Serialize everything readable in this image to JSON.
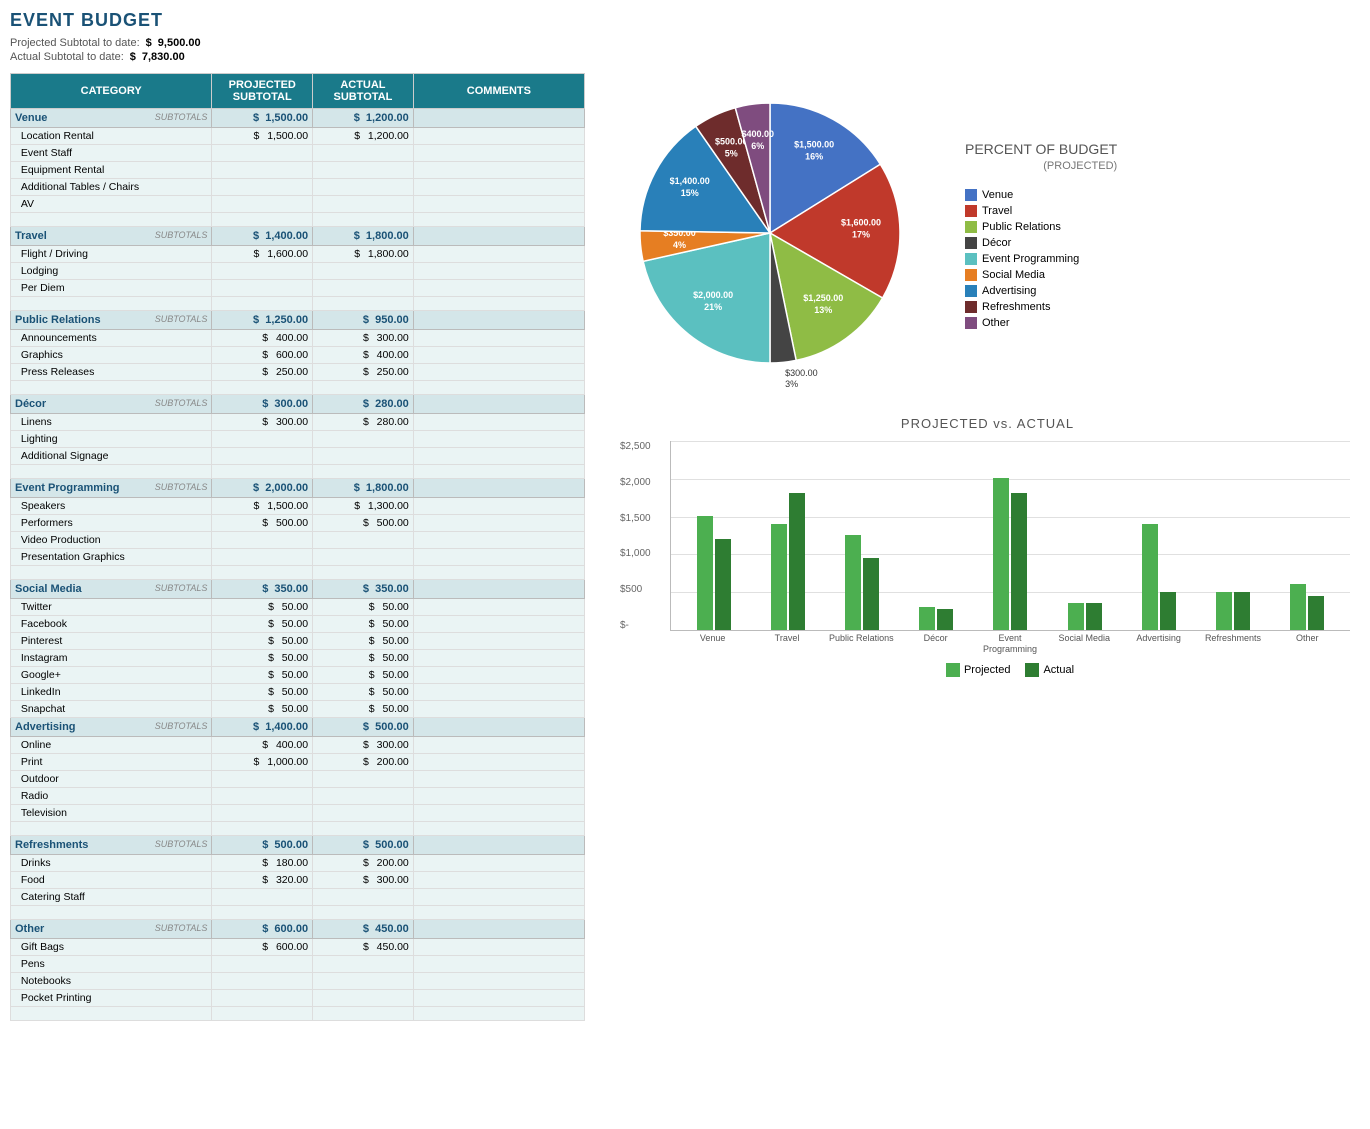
{
  "title": "EVENT BUDGET",
  "summary": {
    "projected_label": "Projected Subtotal to date:",
    "projected_dollar": "$",
    "projected_value": "9,500.00",
    "actual_label": "Actual Subtotal to date:",
    "actual_dollar": "$",
    "actual_value": "7,830.00"
  },
  "table": {
    "headers": {
      "category": "CATEGORY",
      "projected": "PROJECTED SUBTOTAL",
      "actual": "ACTUAL SUBTOTAL",
      "comments": "COMMENTS"
    },
    "categories": [
      {
        "name": "Venue",
        "projected": "1,500.00",
        "actual": "1,200.00",
        "items": [
          {
            "name": "Location Rental",
            "proj": "1,500.00",
            "act": "1,200.00"
          },
          {
            "name": "Event Staff",
            "proj": "",
            "act": ""
          },
          {
            "name": "Equipment Rental",
            "proj": "",
            "act": ""
          },
          {
            "name": "Additional Tables / Chairs",
            "proj": "",
            "act": ""
          },
          {
            "name": "AV",
            "proj": "",
            "act": ""
          }
        ],
        "empty_rows": 1
      },
      {
        "name": "Travel",
        "projected": "1,400.00",
        "actual": "1,800.00",
        "items": [
          {
            "name": "Flight / Driving",
            "proj": "1,600.00",
            "act": "1,800.00"
          },
          {
            "name": "Lodging",
            "proj": "",
            "act": ""
          },
          {
            "name": "Per Diem",
            "proj": "",
            "act": ""
          }
        ],
        "empty_rows": 1
      },
      {
        "name": "Public Relations",
        "projected": "1,250.00",
        "actual": "950.00",
        "items": [
          {
            "name": "Announcements",
            "proj": "400.00",
            "act": "300.00"
          },
          {
            "name": "Graphics",
            "proj": "600.00",
            "act": "400.00"
          },
          {
            "name": "Press Releases",
            "proj": "250.00",
            "act": "250.00"
          }
        ],
        "empty_rows": 1
      },
      {
        "name": "Décor",
        "projected": "300.00",
        "actual": "280.00",
        "items": [
          {
            "name": "Linens",
            "proj": "300.00",
            "act": "280.00"
          },
          {
            "name": "Lighting",
            "proj": "",
            "act": ""
          },
          {
            "name": "Additional Signage",
            "proj": "",
            "act": ""
          }
        ],
        "empty_rows": 1
      },
      {
        "name": "Event Programming",
        "projected": "2,000.00",
        "actual": "1,800.00",
        "items": [
          {
            "name": "Speakers",
            "proj": "1,500.00",
            "act": "1,300.00"
          },
          {
            "name": "Performers",
            "proj": "500.00",
            "act": "500.00"
          },
          {
            "name": "Video Production",
            "proj": "",
            "act": ""
          },
          {
            "name": "Presentation Graphics",
            "proj": "",
            "act": ""
          }
        ],
        "empty_rows": 1
      },
      {
        "name": "Social Media",
        "projected": "350.00",
        "actual": "350.00",
        "items": [
          {
            "name": "Twitter",
            "proj": "50.00",
            "act": "50.00"
          },
          {
            "name": "Facebook",
            "proj": "50.00",
            "act": "50.00"
          },
          {
            "name": "Pinterest",
            "proj": "50.00",
            "act": "50.00"
          },
          {
            "name": "Instagram",
            "proj": "50.00",
            "act": "50.00"
          },
          {
            "name": "Google+",
            "proj": "50.00",
            "act": "50.00"
          },
          {
            "name": "LinkedIn",
            "proj": "50.00",
            "act": "50.00"
          },
          {
            "name": "Snapchat",
            "proj": "50.00",
            "act": "50.00"
          }
        ],
        "empty_rows": 0
      },
      {
        "name": "Advertising",
        "projected": "1,400.00",
        "actual": "500.00",
        "items": [
          {
            "name": "Online",
            "proj": "400.00",
            "act": "300.00"
          },
          {
            "name": "Print",
            "proj": "1,000.00",
            "act": "200.00"
          },
          {
            "name": "Outdoor",
            "proj": "",
            "act": ""
          },
          {
            "name": "Radio",
            "proj": "",
            "act": ""
          },
          {
            "name": "Television",
            "proj": "",
            "act": ""
          }
        ],
        "empty_rows": 1
      },
      {
        "name": "Refreshments",
        "projected": "500.00",
        "actual": "500.00",
        "items": [
          {
            "name": "Drinks",
            "proj": "180.00",
            "act": "200.00"
          },
          {
            "name": "Food",
            "proj": "320.00",
            "act": "300.00"
          },
          {
            "name": "Catering Staff",
            "proj": "",
            "act": ""
          }
        ],
        "empty_rows": 1
      },
      {
        "name": "Other",
        "projected": "600.00",
        "actual": "450.00",
        "items": [
          {
            "name": "Gift Bags",
            "proj": "600.00",
            "act": "450.00"
          },
          {
            "name": "Pens",
            "proj": "",
            "act": ""
          },
          {
            "name": "Notebooks",
            "proj": "",
            "act": ""
          },
          {
            "name": "Pocket Printing",
            "proj": "",
            "act": ""
          }
        ],
        "empty_rows": 1
      }
    ]
  },
  "pie_chart": {
    "title_main": "PERCENT OF BUDGET",
    "title_sub": "(PROJECTED)",
    "slices": [
      {
        "label": "Venue",
        "value": 1500,
        "percent": 16,
        "color": "#4472c4",
        "display": "$1,500.00\n16%"
      },
      {
        "label": "Travel",
        "value": 1600,
        "percent": 17,
        "color": "#c0392b",
        "display": "$1,600.00\n17%"
      },
      {
        "label": "Public Relations",
        "value": 1250,
        "percent": 13,
        "color": "#8fbc45",
        "display": "$1,250.00\n13%"
      },
      {
        "label": "Décor",
        "value": 300,
        "percent": 3,
        "color": "#444",
        "display": "$300.00\n3%"
      },
      {
        "label": "Event Programming",
        "value": 2000,
        "percent": 21,
        "color": "#5bc0c0",
        "display": "$2,000.00\n21%"
      },
      {
        "label": "Social Media",
        "value": 350,
        "percent": 4,
        "color": "#e67e22",
        "display": "$350.00\n4%"
      },
      {
        "label": "Advertising",
        "value": 1400,
        "percent": 15,
        "color": "#2980b9",
        "display": "$1,400.00\n15%"
      },
      {
        "label": "Refreshments",
        "value": 500,
        "percent": 5,
        "color": "#6e2c2c",
        "display": "$500.00\n5%"
      },
      {
        "label": "Other",
        "value": 400,
        "percent": 6,
        "color": "#7f4c7f",
        "display": "$400.00\n6%"
      }
    ]
  },
  "bar_chart": {
    "title": "PROJECTED vs. ACTUAL",
    "categories": [
      "Venue",
      "Travel",
      "Public Relations",
      "Décor",
      "Event\nProgramming",
      "Social Media",
      "Advertising",
      "Refreshments",
      "Other"
    ],
    "projected": [
      1500,
      1400,
      1250,
      300,
      2000,
      350,
      1400,
      500,
      600
    ],
    "actual": [
      1200,
      1800,
      950,
      280,
      1800,
      350,
      500,
      500,
      450
    ],
    "max": 2500,
    "y_labels": [
      "$2,500",
      "$2,000",
      "$1,500",
      "$1,000",
      "$500",
      "$-"
    ],
    "legend_projected": "Projected",
    "legend_actual": "Actual"
  }
}
